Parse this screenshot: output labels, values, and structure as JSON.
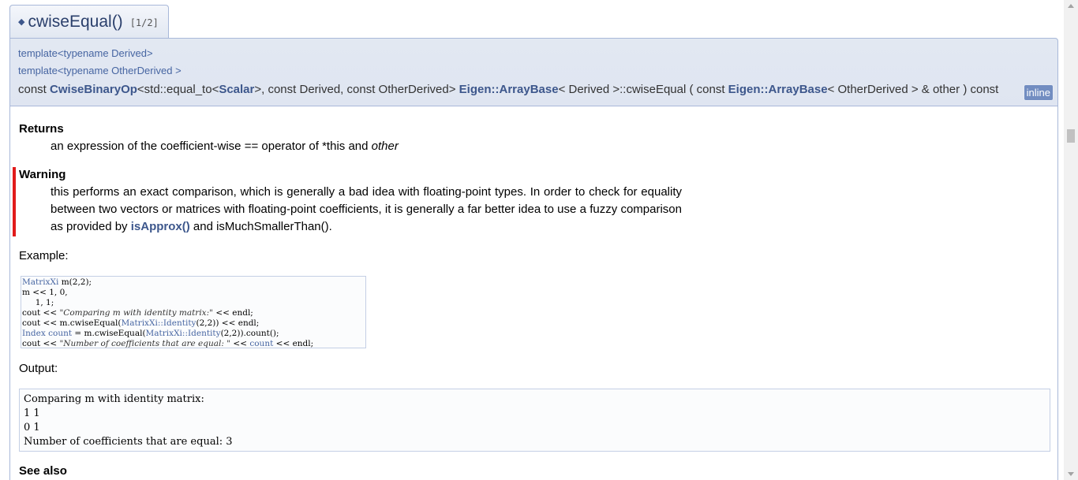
{
  "member": {
    "bullet": "◆",
    "name": "cwiseEqual()",
    "counter": "[1/2]"
  },
  "prototype": {
    "template_lines": [
      "template<typename Derived>",
      "template<typename OtherDerived >"
    ],
    "sig_pre": "const ",
    "sig_type": "CwiseBinaryOp",
    "sig_a": "<std::equal_to<",
    "sig_scalar": "Scalar",
    "sig_b": ">, const Derived, const OtherDerived> ",
    "sig_cls": "Eigen::ArrayBase",
    "sig_c": "< Derived >::cwiseEqual ( const ",
    "sig_cls2": "Eigen::ArrayBase",
    "sig_d": "< OtherDerived > &  other ) const",
    "badge": "inline"
  },
  "returns": {
    "title": "Returns",
    "text_a": "an expression of the coefficient-wise == operator of *this and ",
    "text_em": "other"
  },
  "warning": {
    "title": "Warning",
    "text_a": "this performs an exact comparison, which is generally a bad idea with floating-point types. In order to check for equality between two vectors or matrices with floating-point coefficients, it is generally a far better idea to use a fuzzy comparison as provided by ",
    "link": "isApprox()",
    "text_b": " and isMuchSmallerThan()."
  },
  "example_label": "Example:",
  "code": {
    "l1_type": "MatrixXi",
    "l1_rest": " m(2,2);",
    "l2": "m << 1, 0,",
    "l3": "     1, 1;",
    "l4_a": "cout << ",
    "l4_str": "\"Comparing m with identity matrix:\"",
    "l4_b": " << endl;",
    "l5_a": "cout << m.cwiseEqual(",
    "l5_type": "MatrixXi::Identity",
    "l5_b": "(2,2)) << endl;",
    "l6_type": "Index",
    "l6_var": "count",
    "l6_a": " = m.cwiseEqual(",
    "l6_type2": "MatrixXi::Identity",
    "l6_b": "(2,2)).count();",
    "l7_a": "cout << ",
    "l7_str": "\"Number of coefficients that are equal: \"",
    "l7_b": " << ",
    "l7_var": "count",
    "l7_c": " << endl;"
  },
  "output_label": "Output:",
  "output_lines": [
    "Comparing m with identity matrix:",
    "1 1",
    "0 1",
    "Number of coefficients that are equal: 3"
  ],
  "see_also": "See also"
}
